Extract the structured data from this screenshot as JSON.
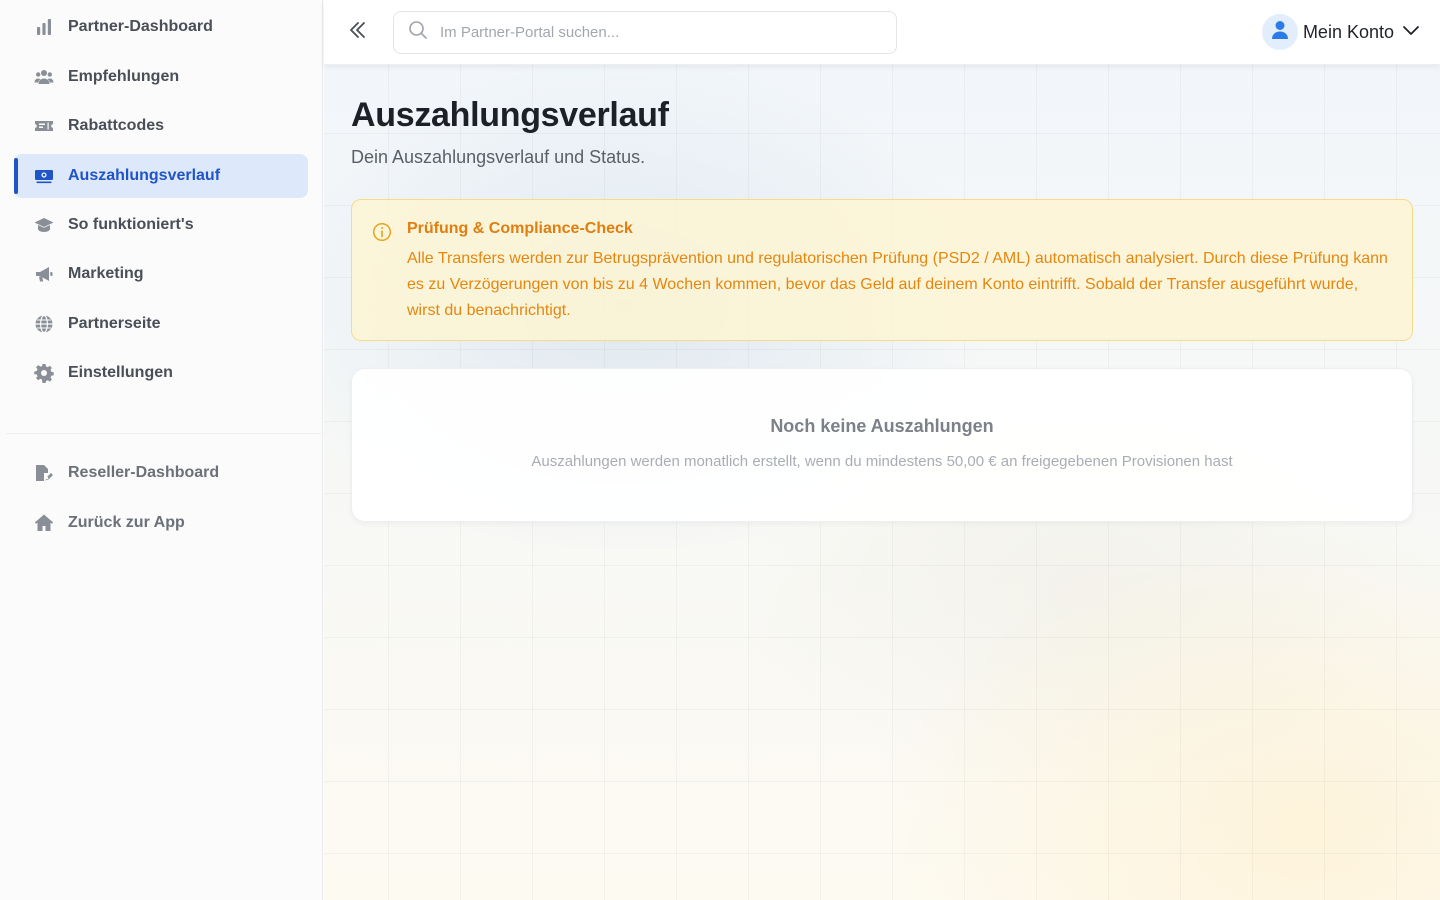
{
  "sidebar": {
    "items": [
      {
        "label": "Partner-Dashboard",
        "icon": "bar-chart-icon"
      },
      {
        "label": "Empfehlungen",
        "icon": "users-icon"
      },
      {
        "label": "Rabattcodes",
        "icon": "ticket-icon"
      },
      {
        "label": "Auszahlungsverlauf",
        "icon": "money-bill-icon",
        "active": true
      },
      {
        "label": "So funktioniert's",
        "icon": "graduation-cap-icon"
      },
      {
        "label": "Marketing",
        "icon": "megaphone-icon"
      },
      {
        "label": "Partnerseite",
        "icon": "globe-icon"
      },
      {
        "label": "Einstellungen",
        "icon": "gear-icon"
      }
    ],
    "secondary_items": [
      {
        "label": "Reseller-Dashboard",
        "icon": "reseller-icon"
      },
      {
        "label": "Zurück zur App",
        "icon": "home-icon"
      }
    ]
  },
  "topbar": {
    "search_placeholder": "Im Partner-Portal suchen...",
    "account_label": "Mein Konto"
  },
  "page": {
    "title": "Auszahlungsverlauf",
    "subtitle": "Dein Auszahlungsverlauf und Status."
  },
  "alert": {
    "title": "Prüfung & Compliance-Check",
    "text": "Alle Transfers werden zur Betrugsprävention und regulatorischen Prüfung (PSD2 / AML) automatisch analysiert. Durch diese Prüfung kann es zu Verzögerungen von bis zu 4 Wochen kommen, bevor das Geld auf deinem Konto eintrifft. Sobald der Transfer ausgeführt wurde, wirst du benachrichtigt."
  },
  "empty_state": {
    "title": "Noch keine Auszahlungen",
    "text": "Auszahlungen werden monatlich erstellt, wenn du mindestens 50,00 € an freigegebenen Provisionen hast"
  },
  "colors": {
    "accent": "#1f55c7",
    "active_bg": "#dde9fb",
    "warning_text": "#e5870f",
    "warning_border": "#f5dc8a"
  }
}
